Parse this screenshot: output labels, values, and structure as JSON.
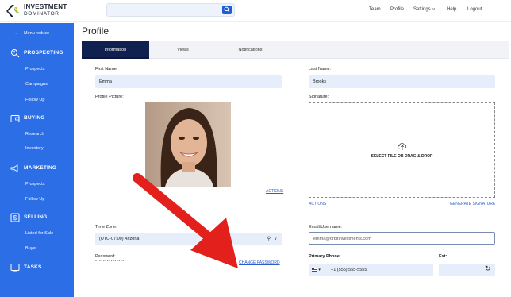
{
  "brand": {
    "line1": "INVESTMENT",
    "line2": "DOMINATOR",
    "colors": {
      "primary": "#2c6ee6",
      "dark": "#10204f",
      "accent_green": "#8cc63f",
      "arrow": "#e3201b"
    }
  },
  "search": {
    "placeholder": "",
    "icon": "search-icon"
  },
  "topnav": {
    "team": "Team",
    "profile": "Profile",
    "settings": "Settings",
    "help": "Help",
    "logout": "Logout"
  },
  "sidebar": {
    "menu_reduce": "Menu reduce",
    "sections": [
      {
        "title": "PROSPECTING",
        "icon": "search-person-icon",
        "items": [
          "Prospects",
          "Campaigns",
          "Follow Up"
        ]
      },
      {
        "title": "BUYING",
        "icon": "wallet-icon",
        "items": [
          "Research",
          "Inventory"
        ]
      },
      {
        "title": "MARKETING",
        "icon": "megaphone-icon",
        "items": [
          "Prospects",
          "Follow Up"
        ]
      },
      {
        "title": "SELLING",
        "icon": "dollar-icon",
        "items": [
          "Listed for Sale",
          "Buyer"
        ]
      },
      {
        "title": "TASKS",
        "icon": "tasks-icon",
        "items": []
      }
    ]
  },
  "page": {
    "title": "Profile",
    "tabs": [
      "Information",
      "Views",
      "Notifications"
    ],
    "active_tab": "Information"
  },
  "form": {
    "first_name_label": "First Name:",
    "first_name_value": "Emma",
    "last_name_label": "Last Name:",
    "last_name_value": "Brooks",
    "profile_picture_label": "Profile Picture:",
    "signature_label": "Signature:",
    "select_file_text": "SELECT FILE OR DRAG & DROP",
    "actions_link": "ACTIONS",
    "signature_actions_link": "ACTIONS",
    "generate_signature_link": "GENERATE SIGNATURE",
    "time_zone_label": "Time Zone:",
    "time_zone_value": "(UTC-07:00) Arizona",
    "email_label": "Email/Username:",
    "email_value": "emma@orbitinvestments.com",
    "password_label": "Password:",
    "password_value": "****************",
    "change_password_link": "CHANGE PASSWORD",
    "primary_phone_label": "Primary Phone:",
    "phone_country": "🇺🇸",
    "phone_value": "+1 (555) 555-5555",
    "ext_label": "Ext:",
    "ext_value": ""
  }
}
